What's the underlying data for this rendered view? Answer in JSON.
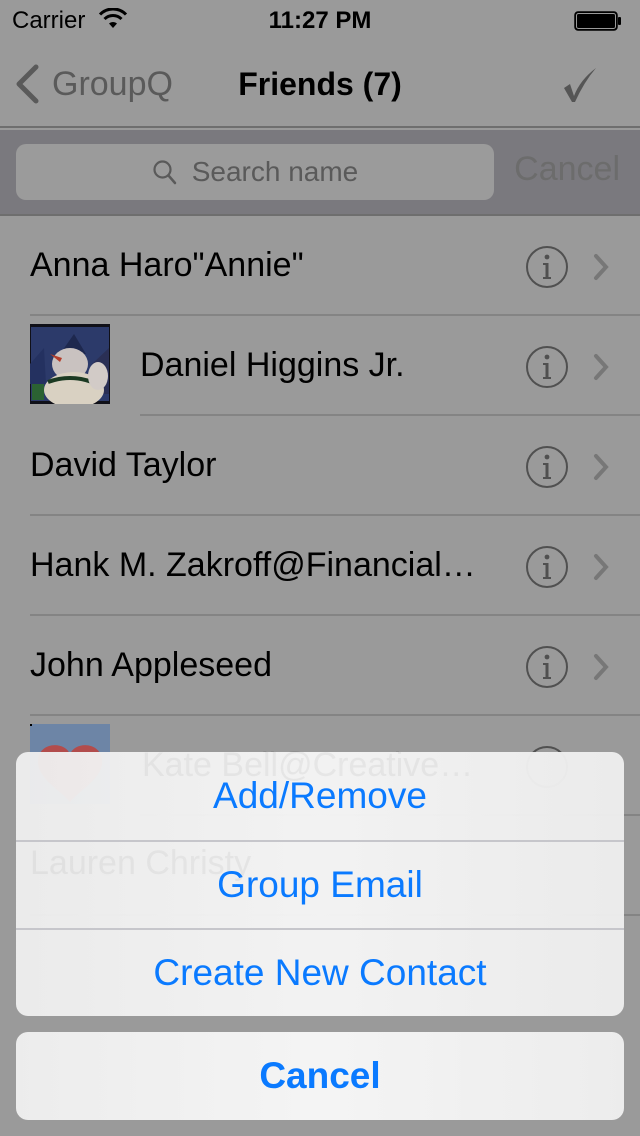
{
  "status_bar": {
    "carrier": "Carrier",
    "time": "11:27 PM",
    "wifi_icon": "wifi-icon",
    "battery_icon": "battery-full-icon"
  },
  "nav_bar": {
    "back_label": "GroupQ",
    "title": "Friends (7)",
    "done_icon": "checkmark-icon"
  },
  "search": {
    "placeholder": "Search name",
    "value": "",
    "cancel_label": "Cancel"
  },
  "contacts": [
    {
      "name": "Anna Haro\"Annie\"",
      "has_avatar": false
    },
    {
      "name": "Daniel Higgins Jr.",
      "has_avatar": true,
      "avatar": "snowman-photo"
    },
    {
      "name": "David Taylor",
      "has_avatar": false
    },
    {
      "name": "Hank M. Zakroff@Financial…",
      "has_avatar": false
    },
    {
      "name": "John Appleseed",
      "has_avatar": false
    },
    {
      "name": "Kate Bell@Creative…",
      "has_avatar": true,
      "avatar": "heart-photo"
    },
    {
      "name": "Lauren Christy",
      "has_avatar": false
    }
  ],
  "action_sheet": {
    "items": [
      {
        "label": "Add/Remove"
      },
      {
        "label": "Group Email"
      },
      {
        "label": "Create New Contact"
      }
    ],
    "cancel_label": "Cancel"
  },
  "colors": {
    "accent": "#0a7aff",
    "dim_overlay": "#9a9a9a"
  }
}
